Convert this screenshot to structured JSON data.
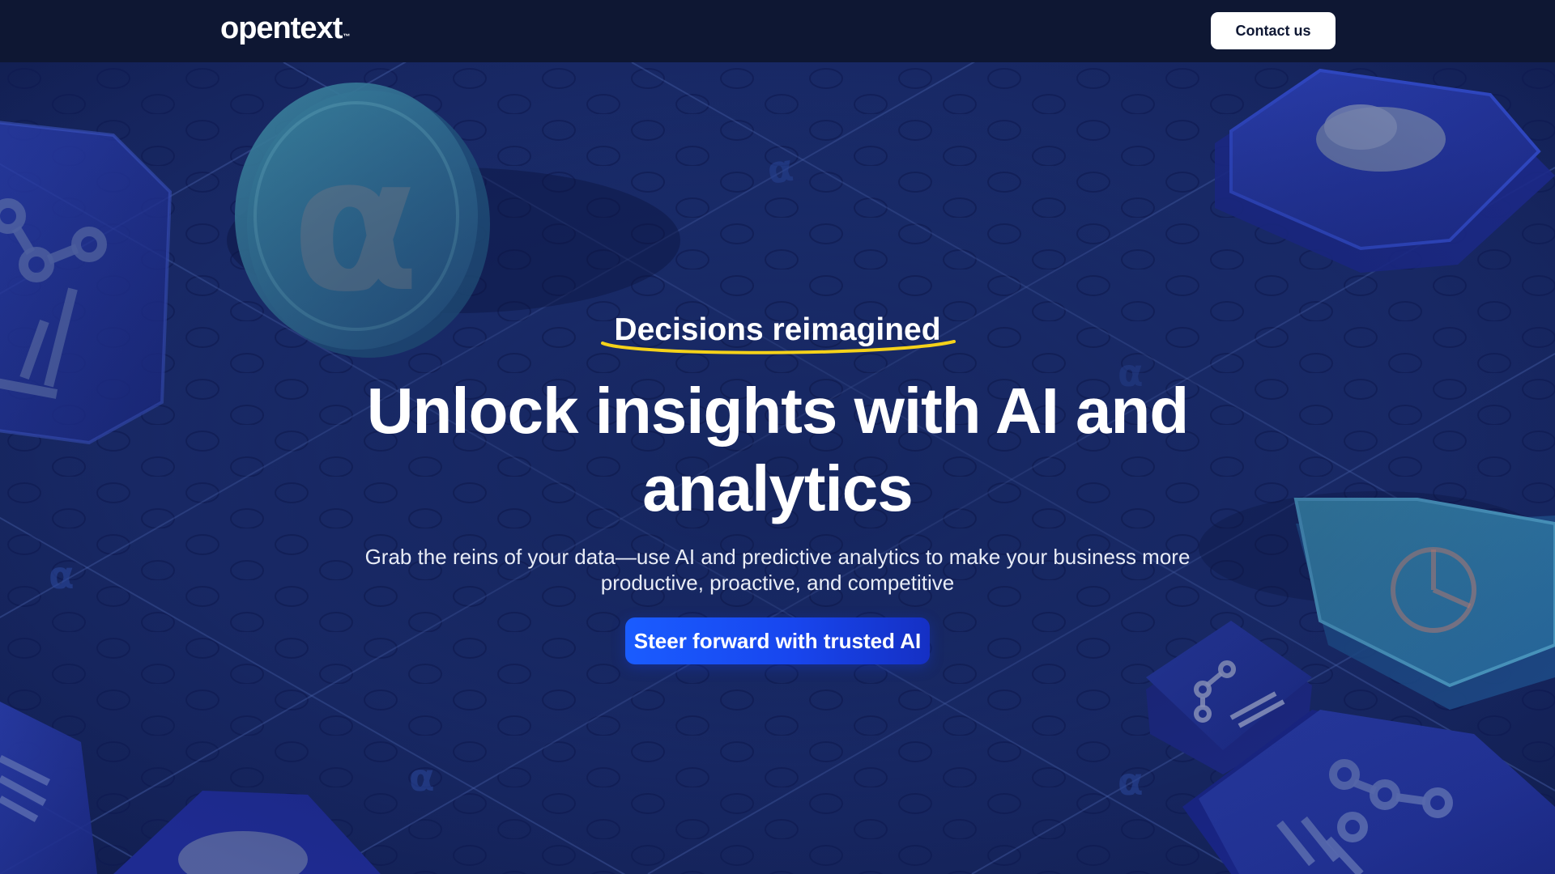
{
  "header": {
    "logo_text": "opentext",
    "logo_trademark": "™",
    "contact_label": "Contact us"
  },
  "hero": {
    "eyebrow": "Decisions reimagined",
    "headline": "Unlock insights with AI and analytics",
    "subtext": "Grab the reins of your data—use AI and predictive analytics to make your business more productive, proactive, and competitive",
    "cta_label": "Steer forward with trusted AI"
  },
  "colors": {
    "topbar_bg": "#0e1733",
    "hero_bg": "#1a2a6c",
    "accent_blue": "#1a5cff",
    "underline_yellow": "#f5d21a",
    "button_text_dark": "#0e1733"
  },
  "icons": [
    "opentext-alpha-coin-icon",
    "network-chart-tile-icon",
    "bar-chart-tile-icon",
    "pie-chart-tile-icon",
    "cloud-tile-icon"
  ]
}
